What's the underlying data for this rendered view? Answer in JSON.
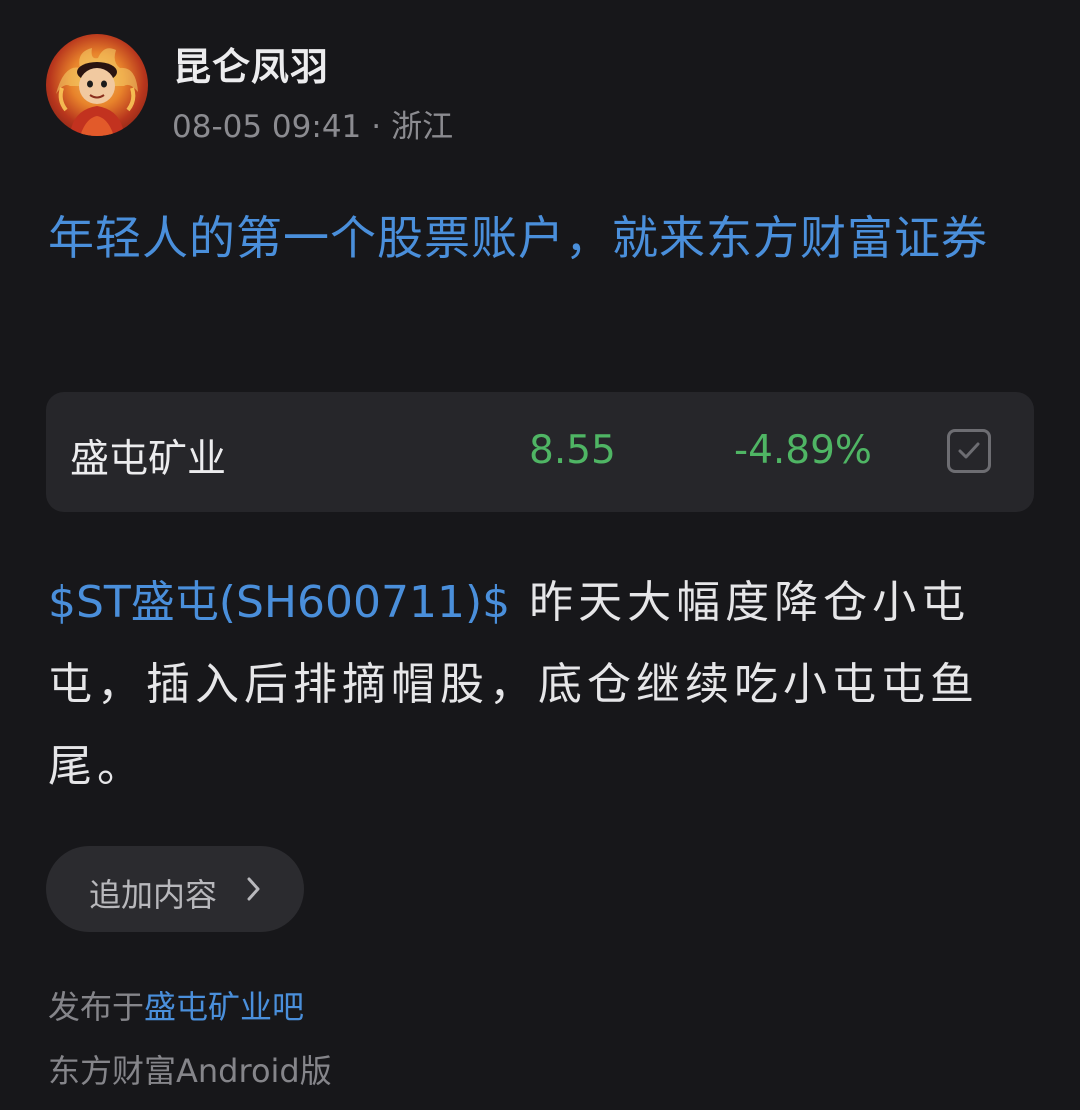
{
  "post": {
    "author": {
      "name": "昆仑凤羽",
      "avatar_icon": "cartoon-avatar-icon"
    },
    "meta": {
      "date": "08-05 09:41",
      "separator": "·",
      "location": "浙江"
    },
    "ad_headline": "年轻人的第一个股票账户，就来东方财富证券",
    "stock_card": {
      "name": "盛屯矿业",
      "price": "8.55",
      "change": "-4.89%",
      "check_icon": "checkbox-checked-icon"
    },
    "body": {
      "stock_link": "$ST盛屯(SH600711)$",
      "text": " 昨天大幅度降仓小屯屯，插入后排摘帽股，底仓继续吃小屯屯鱼尾。"
    },
    "add_content": {
      "label": "追加内容",
      "icon": "chevron-right-icon"
    },
    "footer": {
      "published_prefix": "发布于",
      "forum": "盛屯矿业吧",
      "client": "东方财富Android版"
    }
  },
  "colors": {
    "background": "#17171a",
    "link_blue": "#4a8fdb",
    "stock_down_green": "#4fb564",
    "card_background": "#26262a",
    "muted_text": "#85858a"
  }
}
